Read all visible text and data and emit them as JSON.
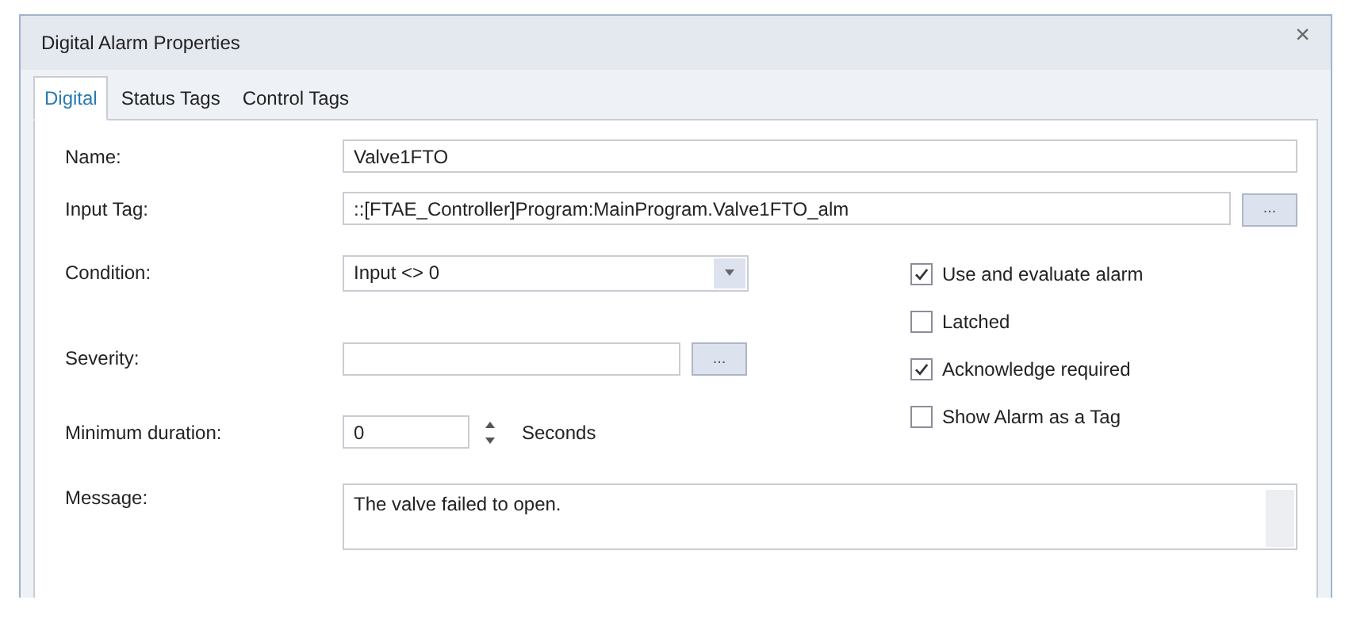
{
  "window": {
    "title": "Digital Alarm Properties",
    "close": "×"
  },
  "tabs": [
    {
      "label": "Digital",
      "selected": true
    },
    {
      "label": "Status Tags",
      "selected": false
    },
    {
      "label": "Control Tags",
      "selected": false
    }
  ],
  "name": {
    "label": "Name:",
    "value": "Valve1FTO"
  },
  "input_tag": {
    "label": "Input Tag:",
    "value": "::[FTAE_Controller]Program:MainProgram.Valve1FTO_alm",
    "button": "..."
  },
  "condition": {
    "label": "Condition:",
    "value": "Input <> 0"
  },
  "severity": {
    "label": "Severity:",
    "button": "..."
  },
  "minimum_duration": {
    "label": "Minimum duration:",
    "value": "0",
    "unit": "Seconds"
  },
  "options": [
    {
      "label": "Use and evaluate alarm",
      "checked": true
    },
    {
      "label": "Latched",
      "checked": false
    },
    {
      "label": "Acknowledge required",
      "checked": true
    },
    {
      "label": "Show Alarm as a Tag",
      "checked": false
    }
  ],
  "message": {
    "label": "Message:",
    "value": "The valve failed to open."
  }
}
